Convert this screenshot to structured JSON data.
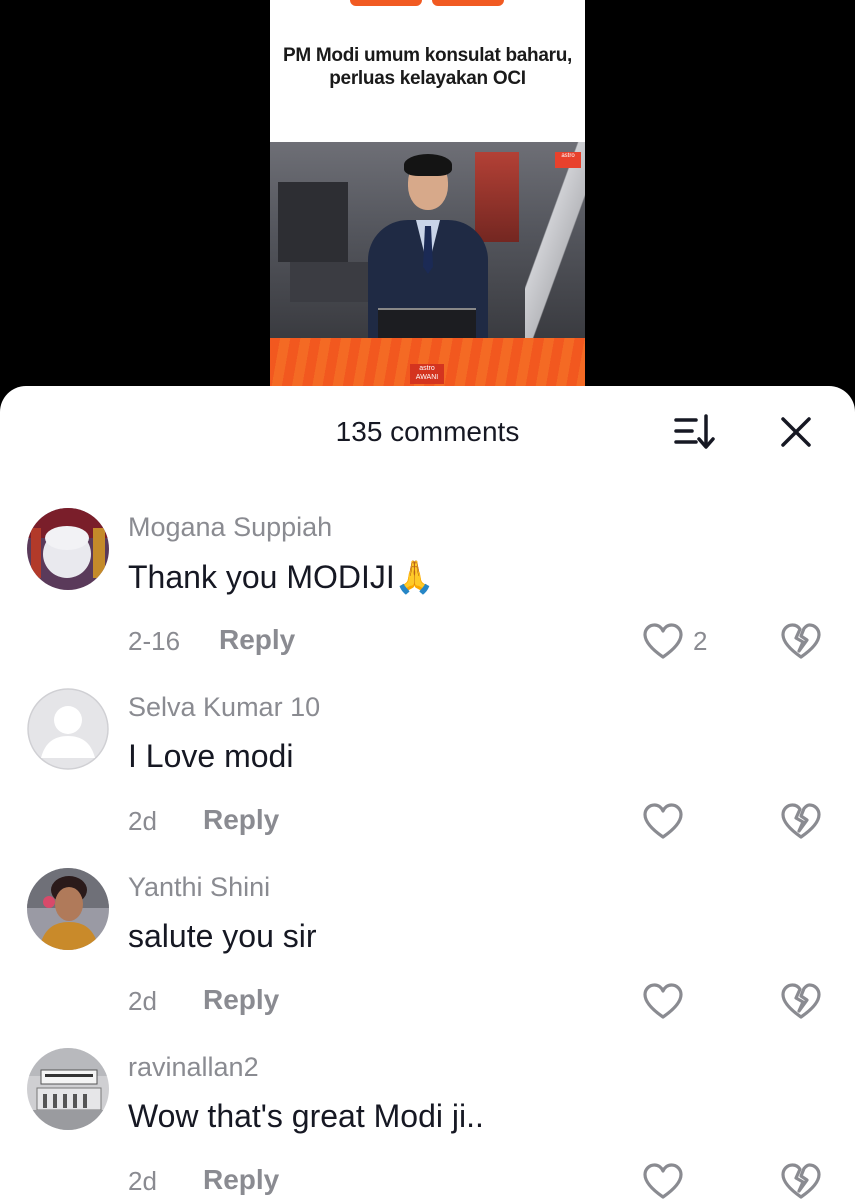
{
  "video": {
    "headline": "PM Modi umum konsulat baharu, perluas kelayakan OCI",
    "channel_logo": "astro AWANI"
  },
  "sheet": {
    "comment_count": "135 comments",
    "sort_icon": "sort-icon",
    "close_icon": "close-icon"
  },
  "comments": [
    {
      "username": "Mogana Suppiah",
      "text": "Thank you MODIJI🙏",
      "date": "2-16",
      "reply_label": "Reply",
      "likes": "2",
      "avatar": "avatar-photo"
    },
    {
      "username": "Selva Kumar 10",
      "text": "I Love modi",
      "date": "2d",
      "reply_label": "Reply",
      "likes": "",
      "avatar": "default-avatar"
    },
    {
      "username": "Yanthi Shini",
      "text": "salute you sir",
      "date": "2d",
      "reply_label": "Reply",
      "likes": "",
      "avatar": "avatar-photo"
    },
    {
      "username": "ravinallan2",
      "text": "Wow that's great Modi ji..",
      "date": "2d",
      "reply_label": "Reply",
      "likes": "",
      "avatar": "avatar-photo"
    }
  ],
  "colors": {
    "accent_orange": "#f15a22",
    "text_primary": "#161823",
    "text_secondary": "#8a8b91"
  }
}
